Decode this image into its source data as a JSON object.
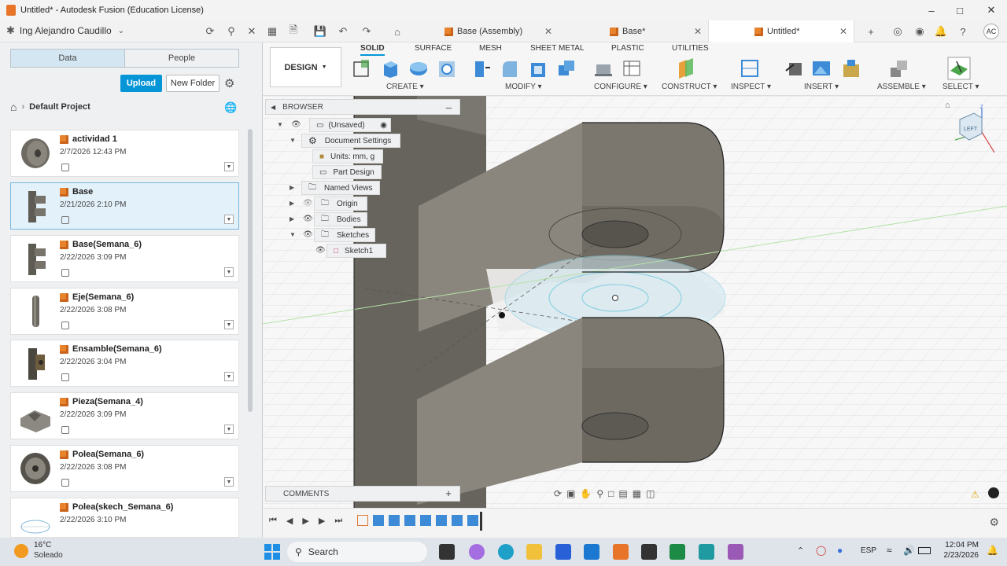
{
  "window": {
    "title": "Untitled* - Autodesk Fusion (Education License)"
  },
  "account": {
    "user": "Ing Alejandro Caudillo",
    "initials": "AC"
  },
  "doc_tabs": [
    {
      "label": "Base (Assembly)"
    },
    {
      "label": "Base*"
    },
    {
      "label": "Untitled*"
    }
  ],
  "data_panel": {
    "tabs": [
      "Data",
      "People"
    ],
    "upload_label": "Upload",
    "new_folder_label": "New Folder",
    "breadcrumb": "Default Project",
    "files": [
      {
        "name": "actividad 1",
        "date": "2/7/2026 12:43 PM"
      },
      {
        "name": "Base",
        "date": "2/21/2026 2:10 PM"
      },
      {
        "name": "Base(Semana_6)",
        "date": "2/22/2026 3:09 PM"
      },
      {
        "name": "Eje(Semana_6)",
        "date": "2/22/2026 3:08 PM"
      },
      {
        "name": "Ensamble(Semana_6)",
        "date": "2/22/2026 3:04 PM"
      },
      {
        "name": "Pieza(Semana_4)",
        "date": "2/22/2026 3:09 PM"
      },
      {
        "name": "Polea(Semana_6)",
        "date": "2/22/2026 3:08 PM"
      },
      {
        "name": "Polea(skech_Semana_6)",
        "date": "2/22/2026 3:10 PM"
      }
    ]
  },
  "toolbar": {
    "workspace": "DESIGN",
    "tabs": [
      "SOLID",
      "SURFACE",
      "MESH",
      "SHEET METAL",
      "PLASTIC",
      "UTILITIES"
    ],
    "groups": [
      "CREATE",
      "MODIFY",
      "CONFIGURE",
      "CONSTRUCT",
      "INSPECT",
      "INSERT",
      "ASSEMBLE",
      "SELECT"
    ]
  },
  "browser": {
    "title": "BROWSER",
    "root": "(Unsaved)",
    "items": [
      "Document Settings",
      "Units: mm, g",
      "Part Design",
      "Named Views",
      "Origin",
      "Bodies",
      "Sketches",
      "Sketch1"
    ]
  },
  "comments": {
    "title": "COMMENTS"
  },
  "viewcube": {
    "face": "LEFT"
  },
  "taskbar": {
    "weather_temp": "16°C",
    "weather_desc": "Soleado",
    "search": "Search",
    "lang": "ESP",
    "time": "12:04 PM",
    "date": "2/23/2026"
  },
  "colors": {
    "accent": "#0696d7",
    "fusion_orange": "#e8742a",
    "model_gray": "#7b776e"
  }
}
